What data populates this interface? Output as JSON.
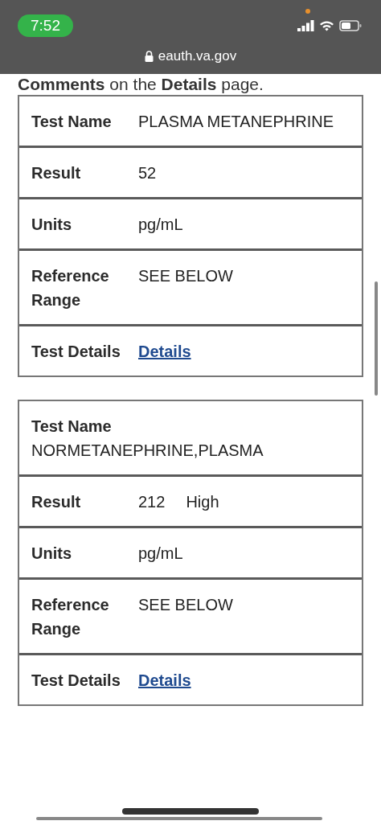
{
  "status_bar": {
    "time": "7:52"
  },
  "address_bar": {
    "url": "eauth.va.gov"
  },
  "intro_text": "**Comments** on the **Details** page.",
  "results": [
    {
      "rows": [
        {
          "kind": "text",
          "label": "Test Name",
          "value": "PLASMA METANEPHRINE"
        },
        {
          "kind": "text",
          "label": "Result",
          "value": "52"
        },
        {
          "kind": "text",
          "label": "Units",
          "value": "pg/mL"
        },
        {
          "kind": "text",
          "label": "Reference Range",
          "value": "SEE BELOW"
        },
        {
          "kind": "link",
          "label": "Test Details",
          "value": "Details"
        }
      ]
    },
    {
      "rows": [
        {
          "kind": "stacked",
          "label": "Test Name",
          "value": "NORMETANEPHRINE,PLASMA"
        },
        {
          "kind": "text",
          "label": "Result",
          "value": "212",
          "flag": "High"
        },
        {
          "kind": "text",
          "label": "Units",
          "value": "pg/mL"
        },
        {
          "kind": "text",
          "label": "Reference Range",
          "value": "SEE BELOW"
        },
        {
          "kind": "link",
          "label": "Test Details",
          "value": "Details"
        }
      ]
    }
  ]
}
